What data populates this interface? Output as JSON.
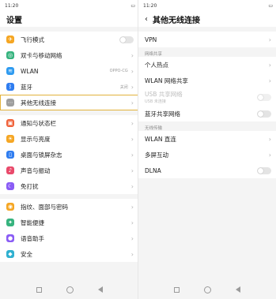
{
  "status_left": {
    "time": "11:20",
    "signal": "all"
  },
  "status_right": {
    "time": "11:20",
    "signal": "all"
  },
  "settings": {
    "title": "设置",
    "groups": [
      [
        {
          "label": "飞行模式",
          "icon": "airplane-icon",
          "color": "#f5a623",
          "control": "toggle"
        },
        {
          "label": "双卡与移动网络",
          "icon": "globe-icon",
          "color": "#36b37e",
          "control": "chevron"
        },
        {
          "label": "WLAN",
          "icon": "wifi-icon",
          "color": "#2f9bf0",
          "control": "chevron",
          "value": "OPPO-CG"
        },
        {
          "label": "蓝牙",
          "icon": "bluetooth-icon",
          "color": "#2f7df0",
          "control": "chevron",
          "value": "关闭"
        },
        {
          "label": "其他无线连接",
          "icon": "more-icon",
          "color": "#9e9e9e",
          "control": "chevron",
          "selected": true
        }
      ],
      [
        {
          "label": "通知与状态栏",
          "icon": "notification-icon",
          "color": "#f0623a",
          "control": "chevron"
        },
        {
          "label": "显示与亮度",
          "icon": "brightness-icon",
          "color": "#f5a623",
          "control": "chevron"
        },
        {
          "label": "桌面与锁屏杂志",
          "icon": "desktop-icon",
          "color": "#2f7df0",
          "control": "chevron"
        },
        {
          "label": "声音与振动",
          "icon": "sound-icon",
          "color": "#e94a6b",
          "control": "chevron"
        },
        {
          "label": "免打扰",
          "icon": "moon-icon",
          "color": "#8a5cf5",
          "control": "chevron"
        }
      ],
      [
        {
          "label": "指纹、面部与密码",
          "icon": "fingerprint-icon",
          "color": "#f5a623",
          "control": "chevron"
        },
        {
          "label": "智能便捷",
          "icon": "smart-icon",
          "color": "#36b37e",
          "control": "chevron"
        },
        {
          "label": "语音助手",
          "icon": "voice-icon",
          "color": "#8a5cf5",
          "control": "chevron"
        },
        {
          "label": "安全",
          "icon": "shield-icon",
          "color": "#2fb0d0",
          "control": "chevron"
        }
      ]
    ]
  },
  "wireless": {
    "title": "其他无线连接",
    "vpn_label": "VPN",
    "section_share": "网络共享",
    "hotspot_label": "个人热点",
    "wlan_share_label": "WLAN 网络共享",
    "usb_share_label": "USB 共享网络",
    "usb_share_sub": "USB 未连接",
    "bt_share_label": "蓝牙共享网络",
    "section_cast": "无线传输",
    "wlan_direct_label": "WLAN 直连",
    "multiscreen_label": "多屏互动",
    "dlna_label": "DLNA"
  }
}
